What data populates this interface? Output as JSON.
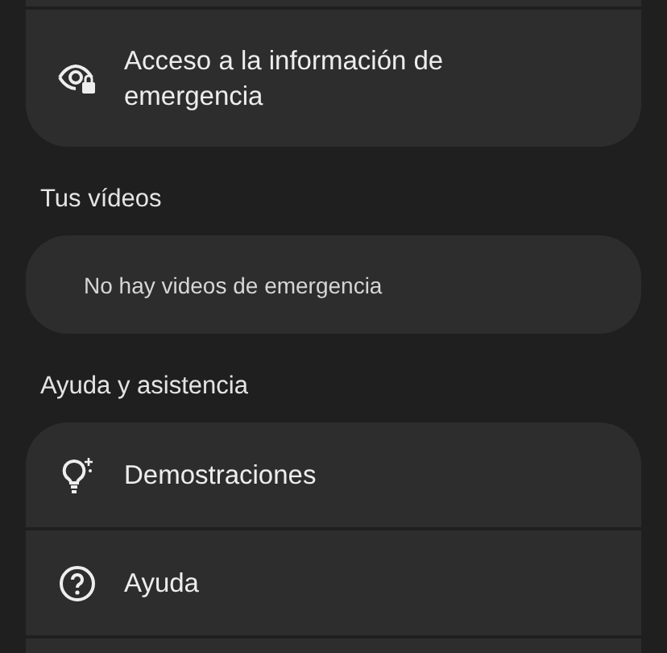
{
  "sections": [
    {
      "items": [
        {
          "kind": "eye-lock",
          "label": "Acceso a la información de emergencia"
        }
      ]
    },
    {
      "title": "Tus vídeos",
      "items": [
        {
          "kind": "empty",
          "label": "No hay videos de emergencia"
        }
      ]
    },
    {
      "title": "Ayuda y asistencia",
      "items": [
        {
          "kind": "bulb",
          "label": "Demostraciones"
        },
        {
          "kind": "help",
          "label": "Ayuda"
        }
      ]
    }
  ]
}
